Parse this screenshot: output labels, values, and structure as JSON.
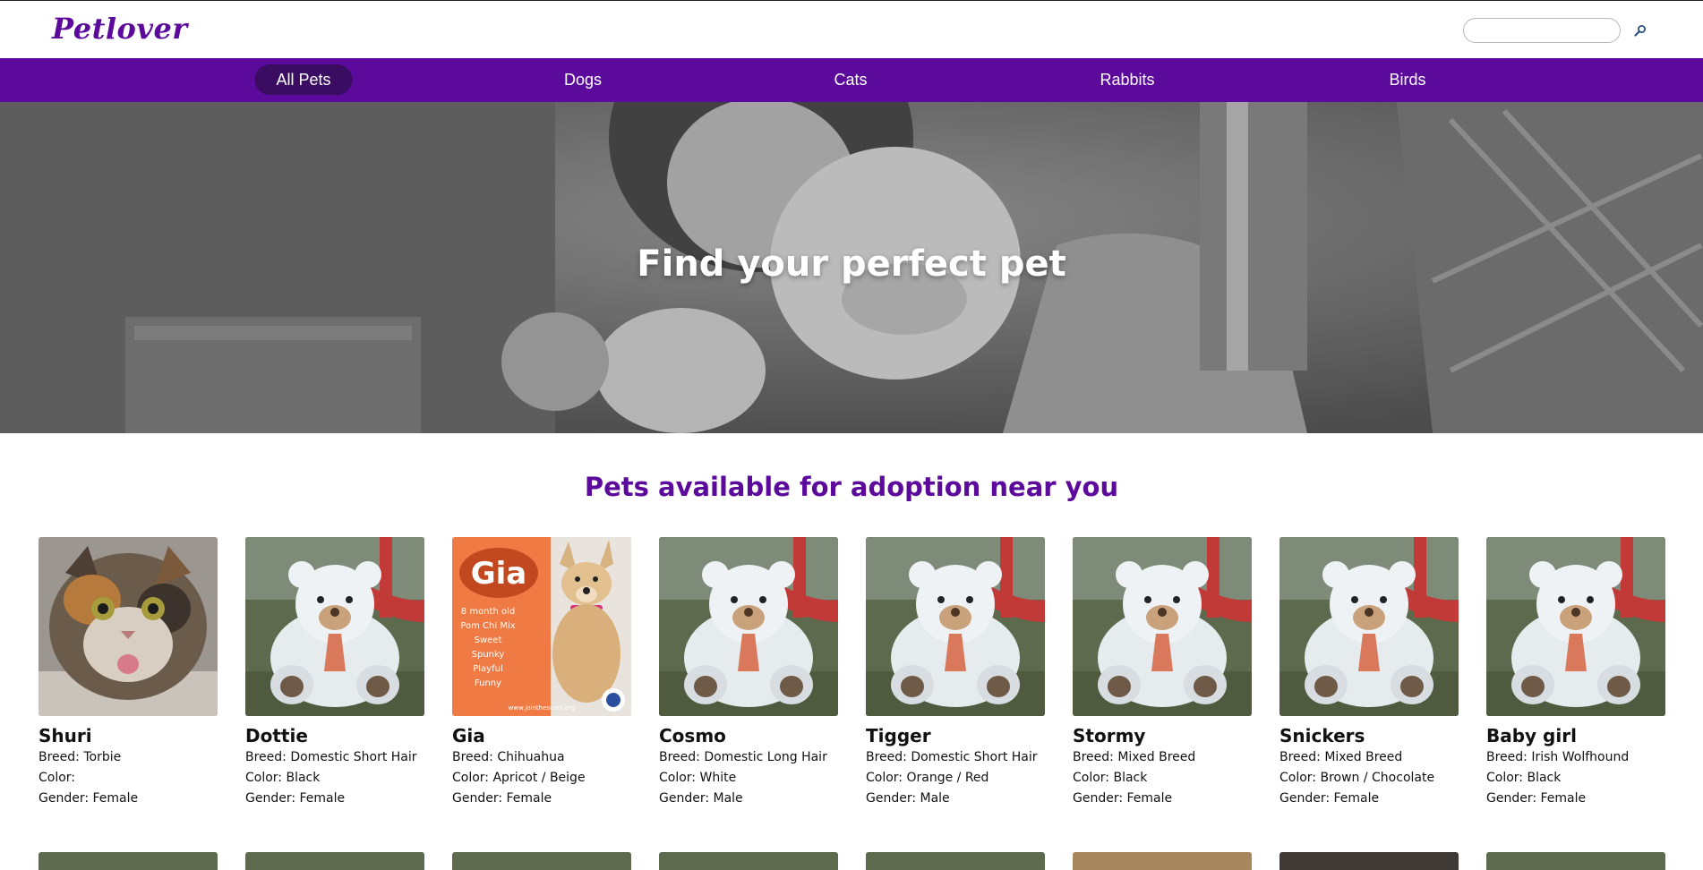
{
  "brand": {
    "logo": "Petlover"
  },
  "search": {
    "placeholder": ""
  },
  "nav": {
    "items": [
      "All Pets",
      "Dogs",
      "Cats",
      "Rabbits",
      "Birds"
    ]
  },
  "hero": {
    "title": "Find your perfect pet"
  },
  "listing": {
    "title": "Pets available for adoption near you",
    "pets": [
      {
        "name": "Shuri",
        "breed": "Breed: Torbie",
        "color": "Color:",
        "gender": "Gender: Female"
      },
      {
        "name": "Dottie",
        "breed": "Breed: Domestic Short Hair",
        "color": "Color: Black",
        "gender": "Gender: Female"
      },
      {
        "name": "Gia",
        "breed": "Breed: Chihuahua",
        "color": "Color: Apricot / Beige",
        "gender": "Gender: Female"
      },
      {
        "name": "Cosmo",
        "breed": "Breed: Domestic Long Hair",
        "color": "Color: White",
        "gender": "Gender: Male"
      },
      {
        "name": "Tigger",
        "breed": "Breed: Domestic Short Hair",
        "color": "Color: Orange / Red",
        "gender": "Gender: Male"
      },
      {
        "name": "Stormy",
        "breed": "Breed: Mixed Breed",
        "color": "Color: Black",
        "gender": "Gender: Female"
      },
      {
        "name": "Snickers",
        "breed": "Breed: Mixed Breed",
        "color": "Color: Brown / Chocolate",
        "gender": "Gender: Female"
      },
      {
        "name": "Baby girl",
        "breed": "Breed: Irish Wolfhound",
        "color": "Color: Black",
        "gender": "Gender: Female"
      }
    ],
    "gia_poster": {
      "name": "Gia",
      "lines": [
        "8 month old",
        "Pom Chi Mix",
        "Sweet",
        "Spunky",
        "Playful",
        "Funny"
      ],
      "url": "www.jointhescars.org"
    }
  },
  "icons": {
    "search": "search-icon"
  },
  "colors": {
    "brand": "#5b0a9c",
    "nav_active": "#3a0d63"
  }
}
